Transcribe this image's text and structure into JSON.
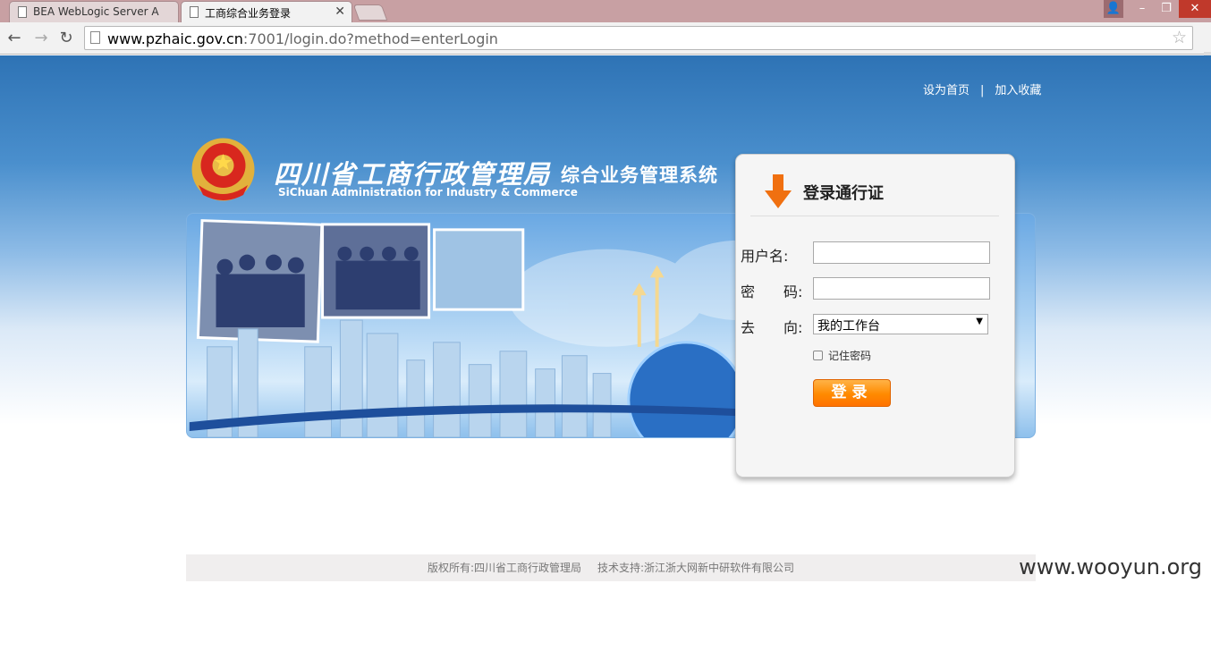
{
  "browser": {
    "tabs": [
      {
        "title": "BEA WebLogic Server A"
      },
      {
        "title": "工商综合业务登录"
      }
    ],
    "url_host": "www.pzhaic.gov.cn",
    "url_rest": ":7001/login.do?method=enterLogin"
  },
  "header": {
    "links": [
      "设为首页",
      "加入收藏"
    ],
    "separator": "|",
    "org_name": "四川省工商行政管理局",
    "org_name_en": "SiChuan Administration for Industry & Commerce",
    "system_name": "综合业务管理系统"
  },
  "login": {
    "title": "登录通行证",
    "username_label": "用户名:",
    "password_label": "密　　码:",
    "goto_label": "去　　向:",
    "goto_selected": "我的工作台",
    "remember_label": "记住密码",
    "submit_label": "登录"
  },
  "footer": {
    "copyright": "版权所有:四川省工商行政管理局",
    "support": "技术支持:浙江浙大网新中研软件有限公司"
  },
  "watermark": "www.wooyun.org",
  "colors": {
    "header_blue": "#2e73b5",
    "button_orange": "#ff8a00",
    "arrow_orange": "#f07010"
  }
}
